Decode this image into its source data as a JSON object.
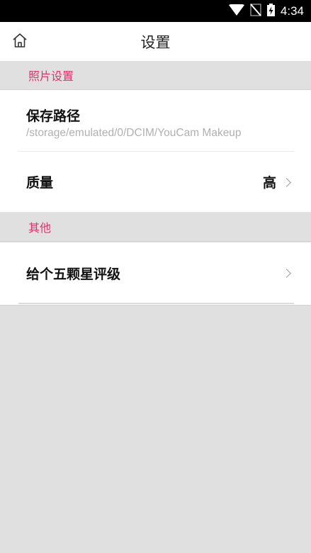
{
  "status_bar": {
    "time": "4:34",
    "icons": [
      "wifi-icon",
      "no-sim-icon",
      "battery-charging-icon"
    ]
  },
  "header": {
    "home_icon": "home-icon",
    "title": "设置"
  },
  "sections": [
    {
      "title": "照片设置",
      "items": [
        {
          "label": "保存路径",
          "sub": "/storage/emulated/0/DCIM/YouCam Makeup"
        },
        {
          "label": "质量",
          "value": "高",
          "chevron": true
        }
      ]
    },
    {
      "title": "其他",
      "items": [
        {
          "label": "给个五颗星评级",
          "chevron": true
        }
      ]
    }
  ],
  "colors": {
    "accent": "#e0336f",
    "background": "#e0e0e0",
    "card": "#ffffff"
  }
}
